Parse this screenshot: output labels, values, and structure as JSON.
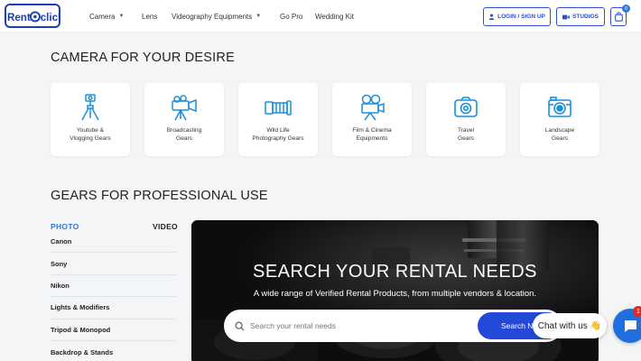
{
  "brand": {
    "logo_text_left": "Rent",
    "logo_text_right": "click",
    "accent": "#2449d8"
  },
  "nav": {
    "items": [
      {
        "label": "Camera",
        "has_dropdown": true
      },
      {
        "label": "Lens",
        "has_dropdown": false
      },
      {
        "label": "Videography Equipments",
        "has_dropdown": true
      },
      {
        "label": "Go Pro",
        "has_dropdown": false
      },
      {
        "label": "Wedding Kit",
        "has_dropdown": false
      }
    ]
  },
  "header_actions": {
    "login_label": "LOGIN / SIGN UP",
    "studios_label": "STUDIOS",
    "cart_count": "0"
  },
  "camera_section": {
    "title": "CAMERA FOR YOUR DESIRE",
    "categories": [
      {
        "label": "Youtube &\nVlogging Gears",
        "icon": "tripod-icon"
      },
      {
        "label": "Broadcasting\nGears",
        "icon": "broadcast-camera-icon"
      },
      {
        "label": "Wild Life\nPhotography Gears",
        "icon": "telephoto-lens-icon"
      },
      {
        "label": "Film & Cinema\nEquipments",
        "icon": "film-camera-icon"
      },
      {
        "label": "Travel\nGears",
        "icon": "travel-camera-icon"
      },
      {
        "label": "Landscape\nGears",
        "icon": "landscape-camera-icon"
      }
    ]
  },
  "gears_section": {
    "title": "GEARS FOR PROFESSIONAL USE",
    "tabs": [
      {
        "label": "PHOTO",
        "active": true
      },
      {
        "label": "VIDEO",
        "active": false
      }
    ],
    "brands": [
      "Canon",
      "Sony",
      "Nikon",
      "Lights & Modifiers",
      "Tripod & Monopod",
      "Backdrop & Stands"
    ]
  },
  "hero": {
    "title": "SEARCH YOUR RENTAL NEEDS",
    "subtitle": "A wide range of Verified Rental Products, from multiple vendors & location.",
    "search_placeholder": "Search your rental needs",
    "search_button": "Search Now"
  },
  "chat": {
    "bubble_text": "Chat with us",
    "bubble_emoji": "👋",
    "badge_count": "1"
  }
}
